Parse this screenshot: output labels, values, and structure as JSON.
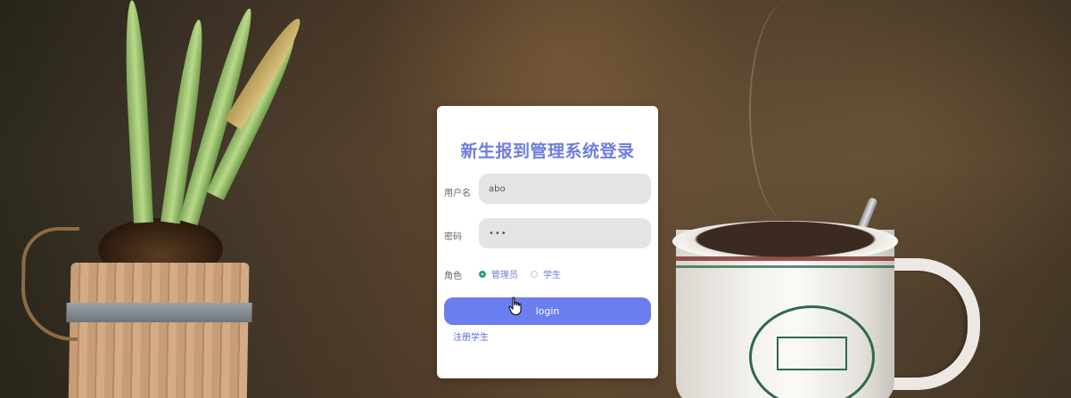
{
  "login": {
    "title": "新生报到管理系统登录",
    "username_label": "用户名",
    "username_value": "abo",
    "password_label": "密码",
    "password_value": "•••",
    "role_label": "角色",
    "roles": [
      {
        "label": "管理员",
        "selected": true
      },
      {
        "label": "学生",
        "selected": false
      }
    ],
    "login_button": "login",
    "register_link": "注册学生"
  },
  "colors": {
    "title": "#6f7ddf",
    "button": "#6b7ef0",
    "radio_selected": "#2aa374",
    "input_bg": "#e4e3e5"
  },
  "icons": [
    "hand-pointer-cursor-icon"
  ]
}
